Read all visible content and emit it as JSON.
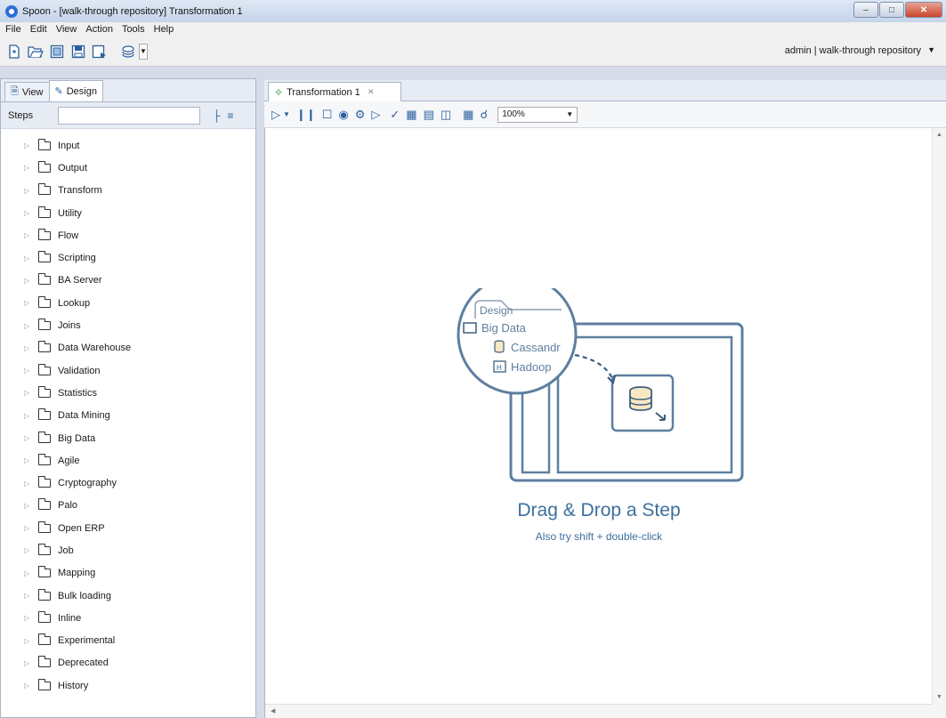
{
  "window": {
    "title": "Spoon - [walk-through repository] Transformation 1",
    "controls": [
      "minimize",
      "maximize",
      "close"
    ]
  },
  "menu": [
    "File",
    "Edit",
    "View",
    "Action",
    "Tools",
    "Help"
  ],
  "toolbar": {
    "icons": [
      "new-file-icon",
      "open-icon",
      "explore-repository-icon",
      "save-icon",
      "save-as-icon",
      "layers-icon"
    ],
    "user_info": "admin | walk-through repository"
  },
  "left_panel": {
    "tabs": [
      {
        "label": "View",
        "icon": "document-icon",
        "active": false
      },
      {
        "label": "Design",
        "icon": "pencil-icon",
        "active": true
      }
    ],
    "steps_label": "Steps",
    "steps_search_value": "",
    "categories": [
      "Input",
      "Output",
      "Transform",
      "Utility",
      "Flow",
      "Scripting",
      "BA Server",
      "Lookup",
      "Joins",
      "Data Warehouse",
      "Validation",
      "Statistics",
      "Data Mining",
      "Big Data",
      "Agile",
      "Cryptography",
      "Palo",
      "Open ERP",
      "Job",
      "Mapping",
      "Bulk loading",
      "Inline",
      "Experimental",
      "Deprecated",
      "History"
    ]
  },
  "editor": {
    "tab_label": "Transformation 1",
    "zoom": "100%",
    "illustration": {
      "tab_label": "Design",
      "folder_label": "Big Data",
      "item1": "Cassandr",
      "item2": "Hadoop"
    },
    "drag_title": "Drag & Drop a Step",
    "drag_subtitle": "Also try shift + double-click"
  }
}
